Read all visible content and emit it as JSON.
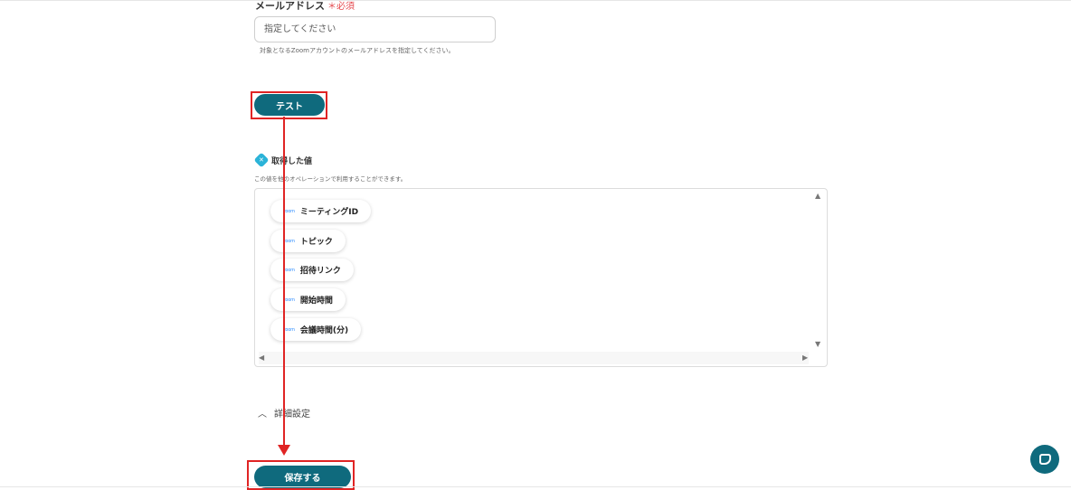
{
  "email_field": {
    "label": "メールアドレス",
    "required_mark": "＊必須",
    "placeholder": "指定してください",
    "help": "対象となるZoomアカウントのメールアドレスを指定してください。"
  },
  "test_button": {
    "label": "テスト"
  },
  "retrieved": {
    "title": "取得した値",
    "subtitle": "この値を他のオペレーションで利用することができます。",
    "items": [
      {
        "logo": "zoom",
        "label": "ミーティングID"
      },
      {
        "logo": "zoom",
        "label": "トピック"
      },
      {
        "logo": "zoom",
        "label": "招待リンク"
      },
      {
        "logo": "zoom",
        "label": "開始時間"
      },
      {
        "logo": "zoom",
        "label": "会議時間(分)"
      }
    ]
  },
  "advanced": {
    "label": "詳細設定"
  },
  "save_button": {
    "label": "保存する"
  },
  "colors": {
    "primary": "#0f6a7d",
    "highlight": "#e02424",
    "required": "#e5484d",
    "zoom": "#2d8cff"
  },
  "icons": {
    "section": "sparkle-diamond-icon",
    "advanced": "chevron-up-icon",
    "chat": "chat-bubble-icon"
  }
}
